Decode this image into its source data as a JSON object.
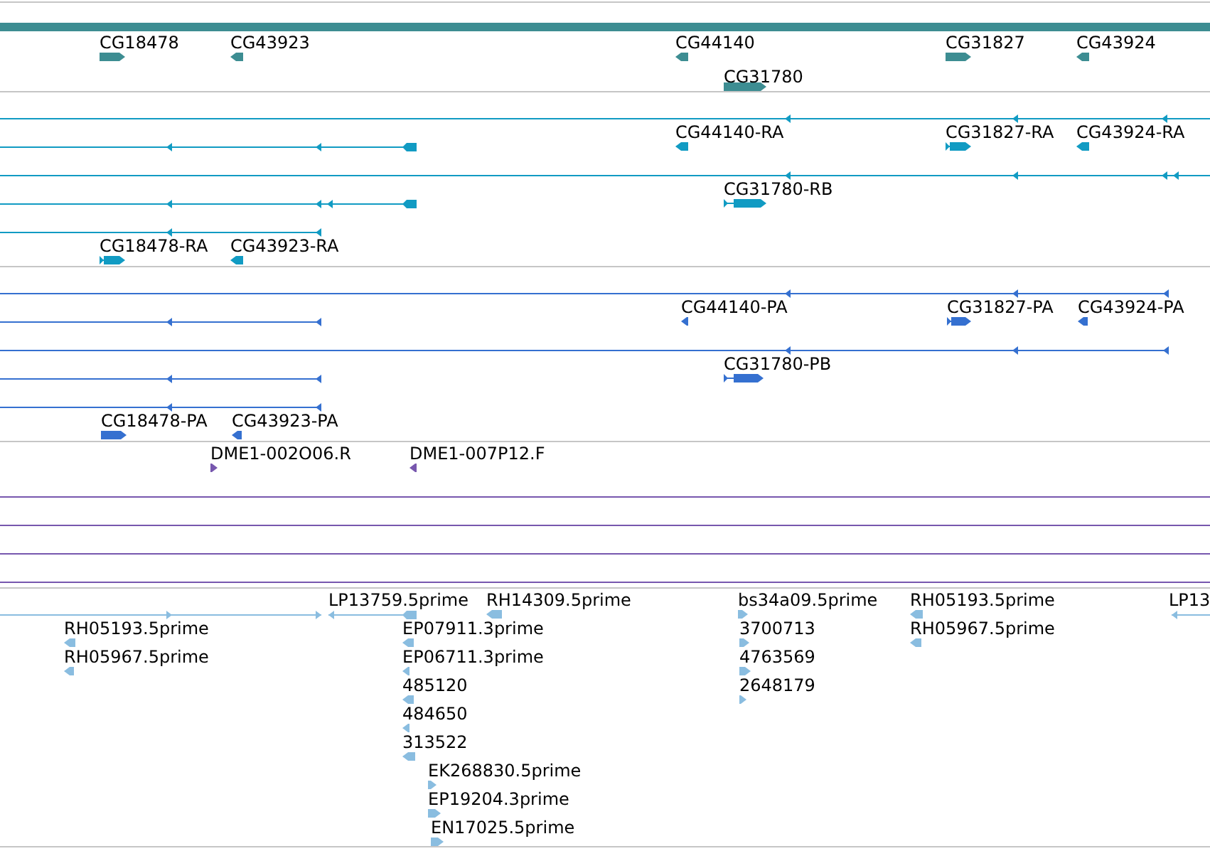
{
  "tracks": [
    {
      "kind": "gene",
      "features": [
        {
          "label": "CG18478",
          "reverse": false
        },
        {
          "label": "CG43923",
          "reverse": true
        },
        {
          "label": "CG44140",
          "reverse": true
        },
        {
          "label": "CG31827",
          "reverse": false
        },
        {
          "label": "CG43924",
          "reverse": true
        },
        {
          "label": "CG31780",
          "reverse": false
        }
      ]
    },
    {
      "kind": "transcript",
      "features": [
        {
          "reverse": true
        },
        {
          "reverse": true
        },
        {
          "label": "CG44140-RA",
          "reverse": true
        },
        {
          "label": "CG31827-RA",
          "reverse": false
        },
        {
          "label": "CG43924-RA",
          "reverse": true
        },
        {
          "reverse": true
        },
        {
          "reverse": true
        },
        {
          "label": "CG31780-RB",
          "reverse": false
        },
        {
          "reverse": true
        },
        {
          "label": "CG18478-RA",
          "reverse": false
        },
        {
          "label": "CG43923-RA",
          "reverse": true
        }
      ]
    },
    {
      "kind": "translation",
      "features": [
        {
          "reverse": true
        },
        {
          "reverse": true
        },
        {
          "label": "CG44140-PA",
          "reverse": true
        },
        {
          "label": "CG31827-PA",
          "reverse": false
        },
        {
          "label": "CG43924-PA",
          "reverse": true
        },
        {
          "reverse": true
        },
        {
          "reverse": true
        },
        {
          "label": "CG31780-PB",
          "reverse": false
        },
        {
          "reverse": true
        },
        {
          "label": "CG18478-PA",
          "reverse": false
        },
        {
          "label": "CG43923-PA",
          "reverse": true
        }
      ]
    },
    {
      "kind": "clone",
      "features": [
        {
          "label": "DME1-002O06.R",
          "reverse": false
        },
        {
          "label": "DME1-007P12.F",
          "reverse": true
        }
      ]
    },
    {
      "kind": "est",
      "features": [
        {
          "reverse": false
        },
        {
          "label": "LP13759.5prime",
          "reverse": true
        },
        {
          "label": "RH14309.5prime",
          "reverse": true
        },
        {
          "label": "bs34a09.5prime",
          "reverse": false
        },
        {
          "label": "RH05193.5prime",
          "reverse": true
        },
        {
          "label": "LP13",
          "reverse": true
        },
        {
          "label": "RH05193.5prime",
          "reverse": true
        },
        {
          "label": "EP07911.3prime",
          "reverse": true
        },
        {
          "label": "3700713",
          "reverse": false
        },
        {
          "label": "RH05967.5prime",
          "reverse": true
        },
        {
          "label": "RH05967.5prime",
          "reverse": true
        },
        {
          "label": "EP06711.3prime",
          "reverse": true
        },
        {
          "label": "4763569",
          "reverse": false
        },
        {
          "label": "485120",
          "reverse": true
        },
        {
          "label": "2648179",
          "reverse": false
        },
        {
          "label": "484650",
          "reverse": true
        },
        {
          "label": "313522",
          "reverse": true
        },
        {
          "label": "EK268830.5prime",
          "reverse": false
        },
        {
          "label": "EP19204.3prime",
          "reverse": false
        },
        {
          "label": "EN17025.5prime",
          "reverse": false
        }
      ]
    }
  ]
}
